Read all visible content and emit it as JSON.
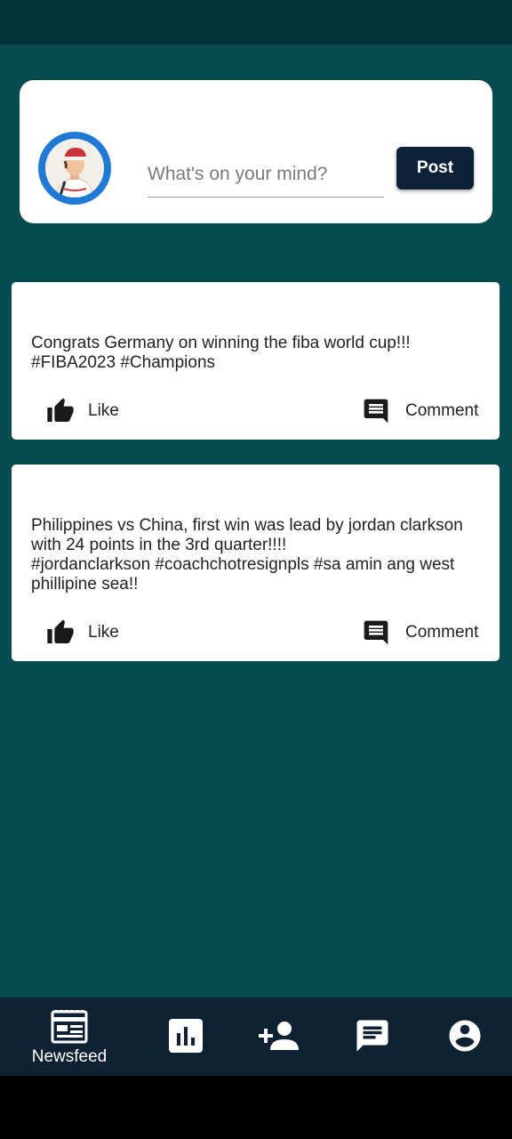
{
  "composer": {
    "placeholder": "What's on your mind?",
    "post_label": "Post"
  },
  "posts": [
    {
      "text": "Congrats Germany on winning the fiba world cup!!!\n#FIBA2023 #Champions",
      "like_label": "Like",
      "comment_label": "Comment"
    },
    {
      "text": "Philippines vs China, first win was lead by jordan clarkson\nwith 24 points in the 3rd quarter!!!!\n#jordanclarkson  #coachchotresignpls #sa amin ang west\nphillipine sea!!",
      "like_label": "Like",
      "comment_label": "Comment"
    }
  ],
  "bottom_nav": {
    "items": [
      {
        "label": "Newsfeed",
        "icon": "newspaper-icon",
        "active": true
      },
      {
        "label": "",
        "icon": "bar-chart-icon"
      },
      {
        "label": "",
        "icon": "add-person-icon"
      },
      {
        "label": "",
        "icon": "message-icon"
      },
      {
        "label": "",
        "icon": "account-icon"
      }
    ]
  },
  "colors": {
    "background": "#064b50",
    "status_bar": "#04343a",
    "nav_bar": "#0f2233",
    "post_button": "#0d2238",
    "avatar_ring": "#1e7ad6"
  }
}
